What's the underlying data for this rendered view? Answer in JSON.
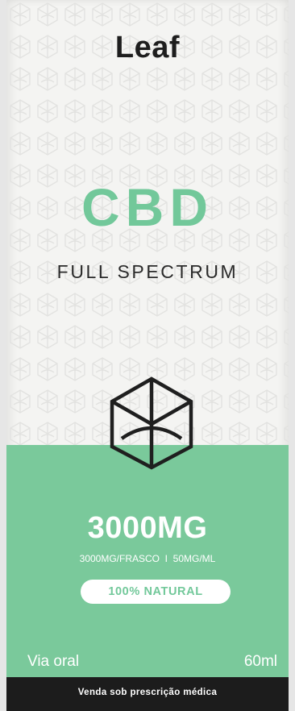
{
  "package": {
    "brand": "Leaf",
    "product": "CBD",
    "subtitle": "FULL SPECTRUM",
    "strength": "3000MG",
    "dosage_info": "3000MG/FRASCO  I  50MG/ML",
    "badge": "100% NATURAL",
    "route": "Via oral",
    "volume": "60ml",
    "prescription_notice": "Venda sob prescrição médica",
    "logo_icon": "cannabis-leaf-hexagon-icon",
    "pattern_icon": "leaf-hexagon-pattern"
  },
  "colors": {
    "box_background": "#f4f4f2",
    "accent_green": "#7ac99b",
    "cbd_text": "#72c89a",
    "brand_text": "#1e1e1e",
    "footer_bar": "#1c1c1c"
  }
}
